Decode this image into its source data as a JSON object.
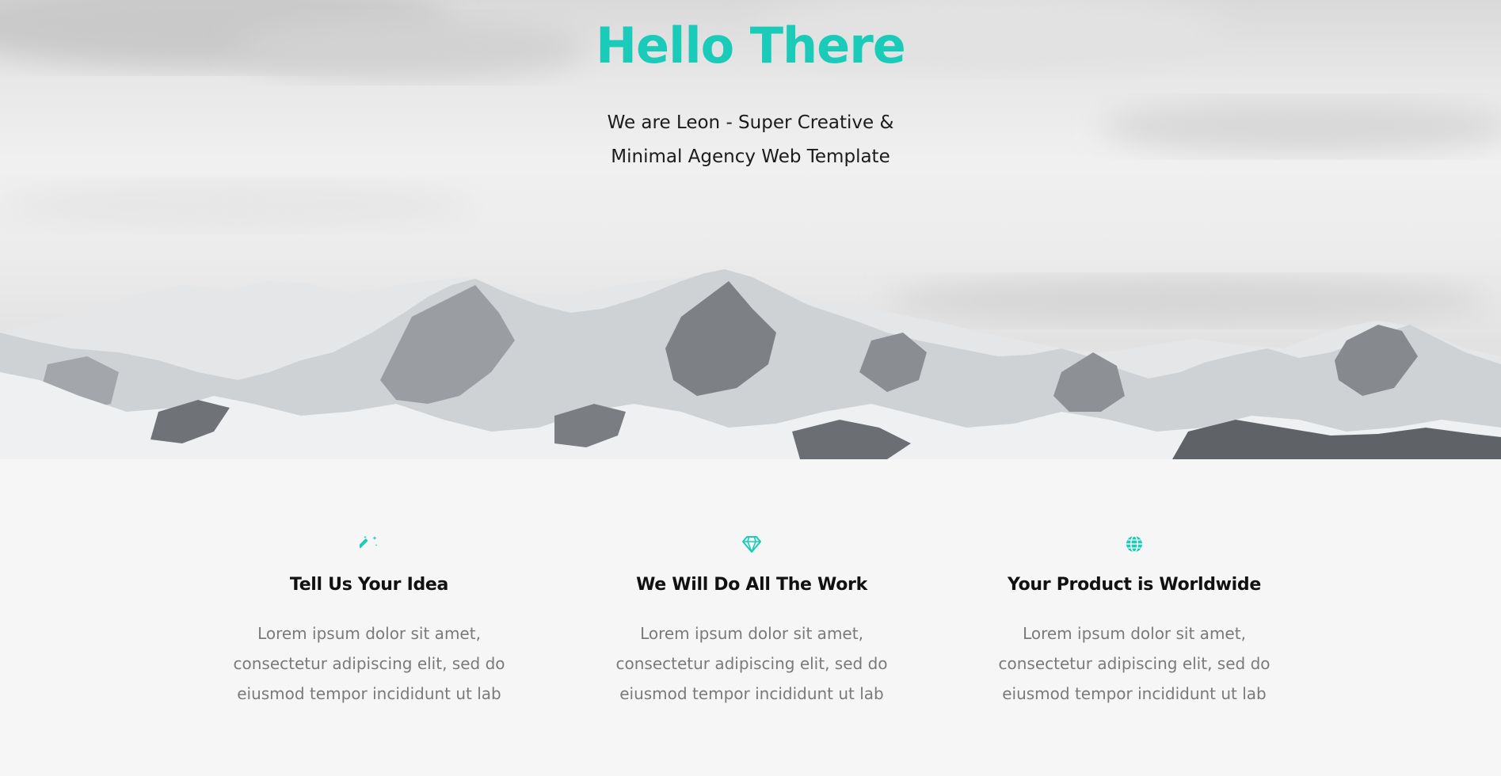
{
  "hero": {
    "title": "Hello There",
    "subtitle_line1": "We are Leon - Super Creative &",
    "subtitle_line2": "Minimal Agency Web Template",
    "background": "mountain-landscape-image"
  },
  "features": [
    {
      "icon": "magic-wand-icon",
      "title": "Tell Us Your Idea",
      "text": "Lorem ipsum dolor sit amet, consectetur adipiscing elit, sed do eiusmod tempor incididunt ut lab"
    },
    {
      "icon": "diamond-icon",
      "title": "We Will Do All The Work",
      "text": "Lorem ipsum dolor sit amet, consectetur adipiscing elit, sed do eiusmod tempor incididunt ut lab"
    },
    {
      "icon": "globe-icon",
      "title": "Your Product is Worldwide",
      "text": "Lorem ipsum dolor sit amet, consectetur adipiscing elit, sed do eiusmod tempor incididunt ut lab"
    }
  ],
  "colors": {
    "accent": "#19cbb8",
    "heading": "#111111",
    "body_text": "#7a7a7a",
    "section_bg": "#f6f6f6"
  }
}
